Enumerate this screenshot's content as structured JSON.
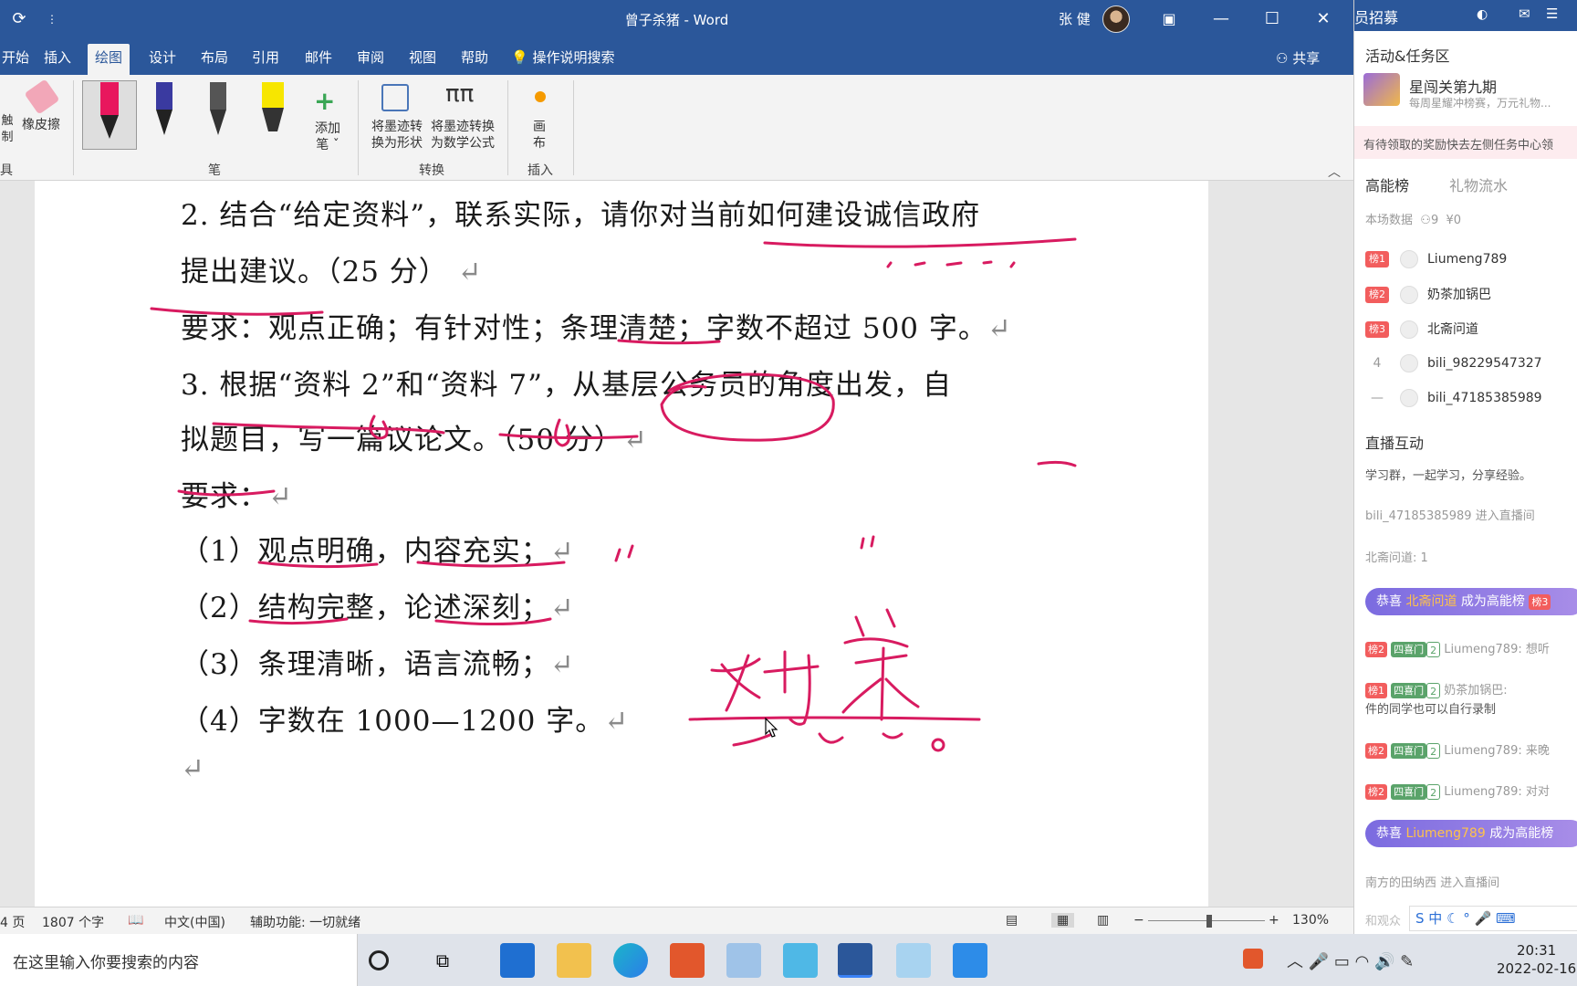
{
  "word": {
    "title": "曾子杀猪 - Word",
    "user": "张 健",
    "tabs": [
      "开始",
      "插入",
      "绘图",
      "设计",
      "布局",
      "引用",
      "邮件",
      "审阅",
      "视图",
      "帮助"
    ],
    "active_tab": "绘图",
    "tell_me": "操作说明搜索",
    "share": "共享",
    "ribbon": {
      "touch_draw": "触\n制",
      "eraser": "橡皮擦",
      "add_pen": "添加\n笔 ˇ",
      "ink_to_shape": "将墨迹转\n换为形状",
      "ink_to_math": "将墨迹转换\n为数学公式",
      "canvas": "画\n布",
      "groups": {
        "tools": "具",
        "pens": "笔",
        "convert": "转换",
        "insert": "插入"
      }
    },
    "document_lines": [
      "2. 结合“给定资料”，联系实际，请你对当前如何建设诚信政府",
      "提出建议。（25 分）",
      "要求：观点正确；有针对性；条理清楚；字数不超过 500 字。",
      "3. 根据“资料 2”和“资料 7”，从基层公务员的角度出发，自",
      "拟题目，写一篇议论文。（50 分）",
      "要求：",
      "（1）观点明确，内容充实；",
      "（2）结构完整，论述深刻；",
      "（3）条理清晰，语言流畅；",
      "（4）字数在 1000—1200 字。"
    ],
    "return_mark": "↵",
    "handwriting": "对策",
    "status": {
      "page": "4 页",
      "words": "1807 个字",
      "language": "中文(中国)",
      "accessibility": "辅助功能: 一切就绪",
      "zoom": "130%"
    }
  },
  "live_panel": {
    "top_title": "员招募",
    "activity_section": "活动&任务区",
    "activity_title": "星闯关第九期",
    "activity_sub": "每周星耀冲榜赛，万元礼物...",
    "reward_notice": "有待领取的奖励快去左侧任务中心领",
    "rank_tab": "高能榜",
    "gift_tab": "礼物流水",
    "stats": {
      "label": "本场数据",
      "viewers": "9",
      "revenue": "¥0"
    },
    "ranks": [
      {
        "badge": "榜1",
        "name": "Liumeng789"
      },
      {
        "badge": "榜2",
        "name": "奶茶加锅巴"
      },
      {
        "badge": "榜3",
        "name": "北斋问道"
      },
      {
        "badge": "4",
        "name": "bili_98229547327"
      },
      {
        "badge": "—",
        "name": "bili_47185385989"
      }
    ],
    "interact_section": "直播互动",
    "messages": [
      "学习群，一起学习，分享经验。",
      "bili_47185385989 进入直播间",
      "北斋问道: 1"
    ],
    "congrats1": {
      "prefix": "恭喜 ",
      "name": "北斋问道",
      "suffix": " 成为高能榜",
      "badge": "榜3"
    },
    "chat": [
      {
        "badge": "榜2",
        "medal": "四喜门",
        "level": "2",
        "text": "Liumeng789: 想听"
      },
      {
        "badge": "榜1",
        "medal": "四喜门",
        "level": "2",
        "text": "奶茶加锅巴:",
        "extra": "件的同学也可以自行录制"
      },
      {
        "badge": "榜2",
        "medal": "四喜门",
        "level": "2",
        "text": "Liumeng789: 来晚"
      },
      {
        "badge": "榜2",
        "medal": "四喜门",
        "level": "2",
        "text": "Liumeng789: 对对"
      }
    ],
    "congrats2": {
      "prefix": "恭喜 ",
      "name": "Liumeng789",
      "suffix": " 成为高能榜"
    },
    "entry": "南方的田纳西 进入直播间",
    "input_hint": "和观众"
  },
  "taskbar": {
    "search_placeholder": "在这里输入你要搜索的内容",
    "time": "20:31",
    "date": "2022-02-16",
    "ime": "中"
  },
  "colors": {
    "word_blue": "#2b579a",
    "ink": "#d81b60",
    "bili_pink": "#f25d5d"
  }
}
